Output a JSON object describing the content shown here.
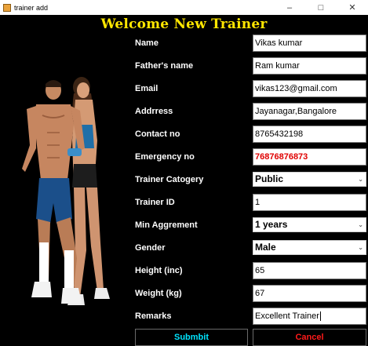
{
  "window": {
    "title": "trainer add",
    "minimize": "–",
    "maximize": "□",
    "close": "✕"
  },
  "heading": "Welcome New Trainer",
  "form": {
    "name": {
      "label": "Name",
      "value": "Vikas kumar"
    },
    "father_name": {
      "label": "Father's name",
      "value": "Ram kumar"
    },
    "email": {
      "label": "Email",
      "value": "vikas123@gmail.com"
    },
    "address": {
      "label": "Addrress",
      "value": "Jayanagar,Bangalore"
    },
    "contact": {
      "label": "Contact no",
      "value": "8765432198"
    },
    "emergency": {
      "label": "Emergency no",
      "value": "76876876873"
    },
    "category": {
      "label": "Trainer Catogery",
      "value": "Public"
    },
    "trainer_id": {
      "label": "Trainer ID",
      "value": "1"
    },
    "agreement": {
      "label": "Min Aggrement",
      "value": "1 years"
    },
    "gender": {
      "label": "Gender",
      "value": "Male"
    },
    "height": {
      "label": "Height (inc)",
      "value": "65"
    },
    "weight": {
      "label": "Weight (kg)",
      "value": "67"
    },
    "remarks": {
      "label": "Remarks",
      "value": "Excellent Trainer"
    }
  },
  "buttons": {
    "submit": "Submbit",
    "cancel": "Cancel"
  },
  "colors": {
    "heading": "#ffe600",
    "submit": "#00e5ff",
    "cancel": "#ff1a1a",
    "emergency_text": "#e00000"
  },
  "icons": {
    "dropdown": "chevron-down-icon",
    "app": "java-cup-icon"
  }
}
